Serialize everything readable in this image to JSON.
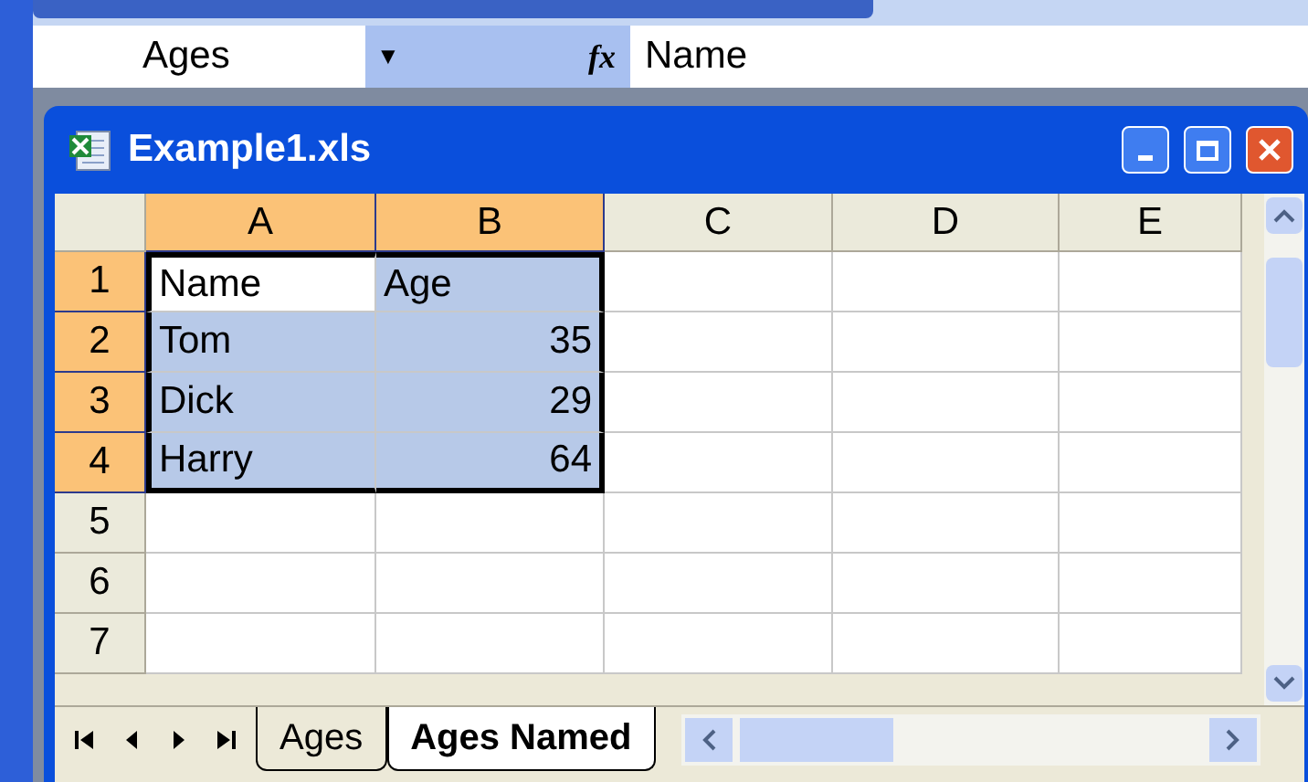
{
  "formula_bar": {
    "name_box": "Ages",
    "dropdown": "▼",
    "fx": "fx",
    "value": "Name"
  },
  "window": {
    "title": "Example1.xls"
  },
  "columns": [
    {
      "label": "A",
      "selected": true
    },
    {
      "label": "B",
      "selected": true
    },
    {
      "label": "C",
      "selected": false
    },
    {
      "label": "D",
      "selected": false
    },
    {
      "label": "E",
      "selected": false
    }
  ],
  "rows": [
    {
      "header": "1",
      "selected": true,
      "cells": [
        {
          "text": "Name",
          "kind": "text",
          "selected": true,
          "active": true
        },
        {
          "text": "Age",
          "kind": "text",
          "selected": true,
          "active": false
        }
      ]
    },
    {
      "header": "2",
      "selected": true,
      "cells": [
        {
          "text": "Tom",
          "kind": "text",
          "selected": true,
          "active": false
        },
        {
          "text": "35",
          "kind": "number",
          "selected": true,
          "active": false
        }
      ]
    },
    {
      "header": "3",
      "selected": true,
      "cells": [
        {
          "text": "Dick",
          "kind": "text",
          "selected": true,
          "active": false
        },
        {
          "text": "29",
          "kind": "number",
          "selected": true,
          "active": false
        }
      ]
    },
    {
      "header": "4",
      "selected": true,
      "cells": [
        {
          "text": "Harry",
          "kind": "text",
          "selected": true,
          "active": false
        },
        {
          "text": "64",
          "kind": "number",
          "selected": true,
          "active": false
        }
      ]
    },
    {
      "header": "5",
      "selected": false
    },
    {
      "header": "6",
      "selected": false
    },
    {
      "header": "7",
      "selected": false
    }
  ],
  "sheet_tabs": [
    {
      "label": "Ages",
      "selected": false
    },
    {
      "label": "Ages Named",
      "selected": true
    }
  ]
}
